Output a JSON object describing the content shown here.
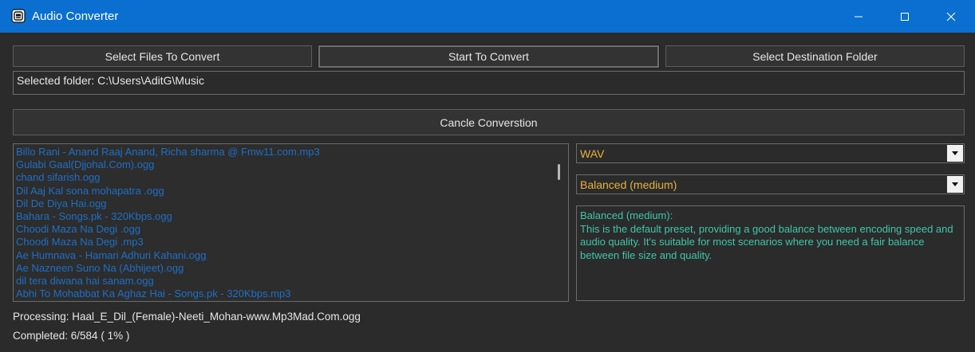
{
  "window": {
    "title": "Audio Converter",
    "accent": "#0a6fd0"
  },
  "toolbar": {
    "select_files_label": "Select Files To Convert",
    "start_convert_label": "Start To Convert",
    "select_destination_label": "Select Destination Folder"
  },
  "folder": {
    "text": "Selected folder: C:\\Users\\AditG\\Music"
  },
  "cancel_label": "Cancle Converstion",
  "files": [
    "Billo Rani - Anand Raaj Anand, Richa sharma @ Fmw11.com.mp3",
    "Gulabi Gaal(Djjohal.Com).ogg",
    "chand sifarish.ogg",
    "Dil Aaj Kal sona mohapatra .ogg",
    "Dil De Diya Hai.ogg",
    "Bahara - Songs.pk - 320Kbps.ogg",
    "Choodi Maza Na Degi .ogg",
    "Choodi Maza Na Degi .mp3",
    "Ae Humnava - Hamari Adhuri Kahani.ogg",
    "Ae Nazneen Suno Na (Abhijeet).ogg",
    "dil tera diwana hai sanam.ogg",
    "Abhi To Mohabbat Ka Aghaz Hai - Songs.pk - 320Kbps.mp3"
  ],
  "format": {
    "selected": "WAV"
  },
  "preset": {
    "selected": "Balanced (medium)"
  },
  "description": {
    "heading": "Balanced (medium):",
    "body": "This is the default preset, providing a good balance between encoding speed and audio quality. It's suitable for most scenarios where you need a fair balance between file size and quality."
  },
  "status": {
    "processing": "Processing: Haal_E_Dil_(Female)-Neeti_Mohan-www.Mp3Mad.Com.ogg",
    "completed": "Completed: 6/584 ( 1% )"
  }
}
